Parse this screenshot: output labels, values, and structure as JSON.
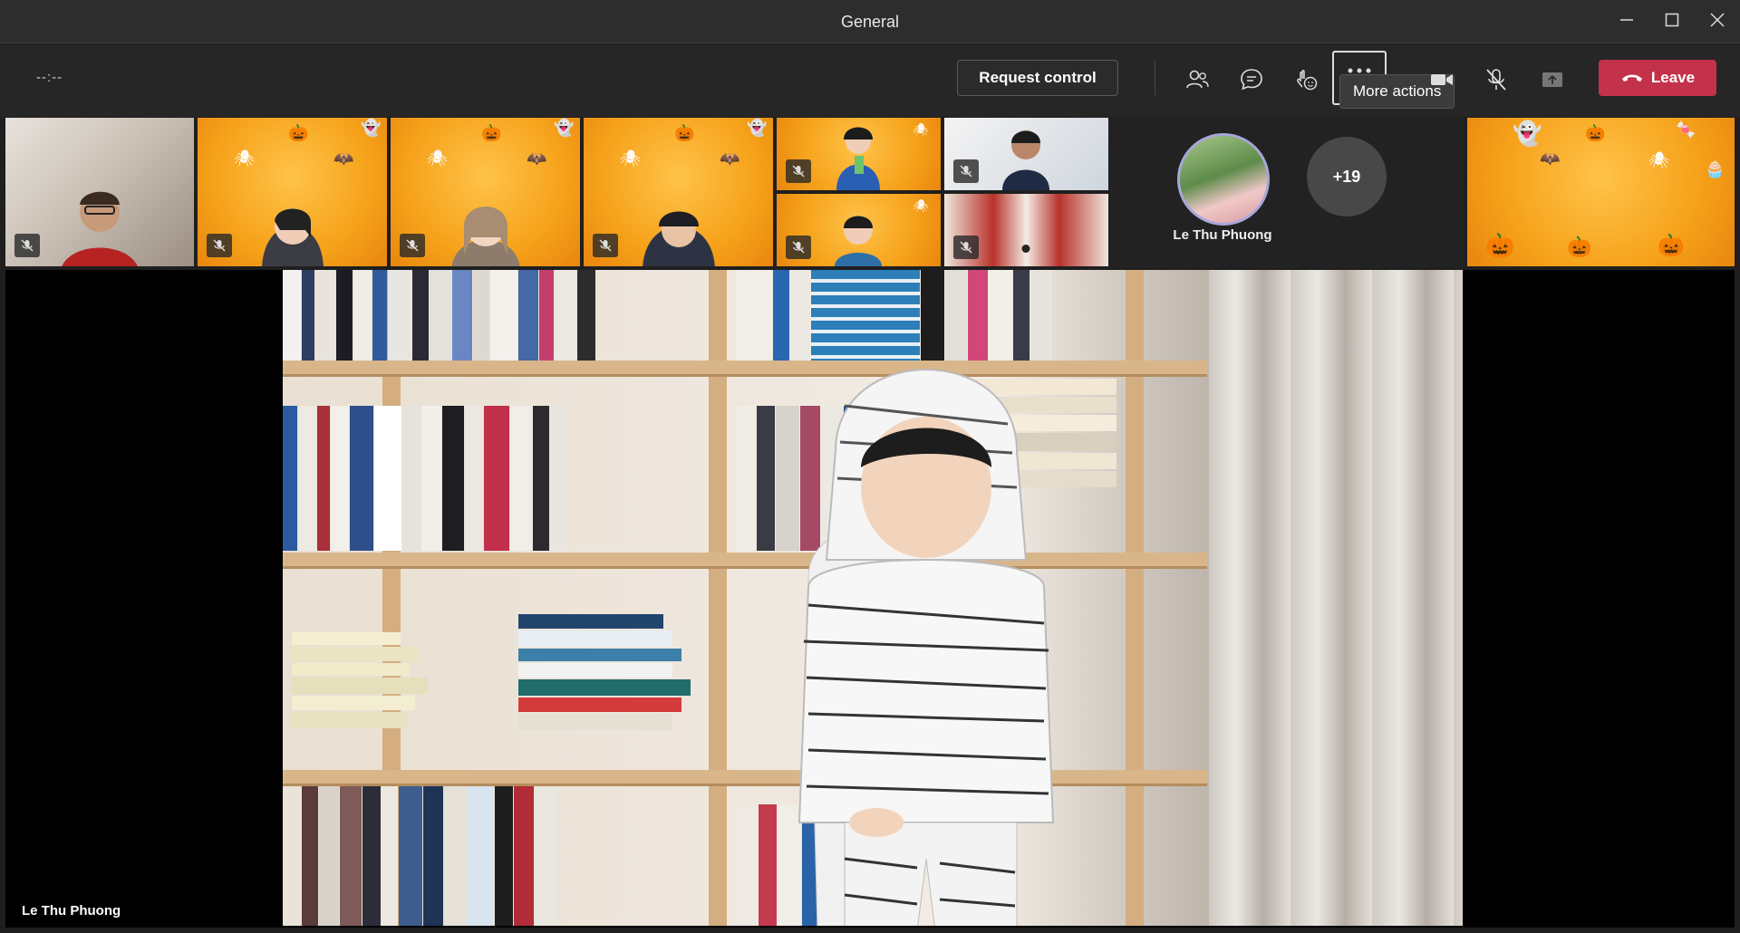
{
  "window": {
    "title": "General",
    "controls": [
      "minimize-icon",
      "maximize-icon",
      "close-icon"
    ]
  },
  "toolbar": {
    "timer": "--:--",
    "request_control_label": "Request control",
    "icons": [
      "people-icon",
      "chat-icon",
      "reactions-icon",
      "more-actions-icon",
      "camera-icon",
      "mic-off-icon",
      "share-screen-icon"
    ],
    "more_actions_tooltip": "More actions",
    "leave_label": "Leave",
    "leave_color": "#c4314b"
  },
  "participants": {
    "featured_name": "Le Thu Phuong",
    "overflow_count": "+19",
    "tile_count": 10
  },
  "stage": {
    "speaker_label": "Le Thu Phuong"
  }
}
